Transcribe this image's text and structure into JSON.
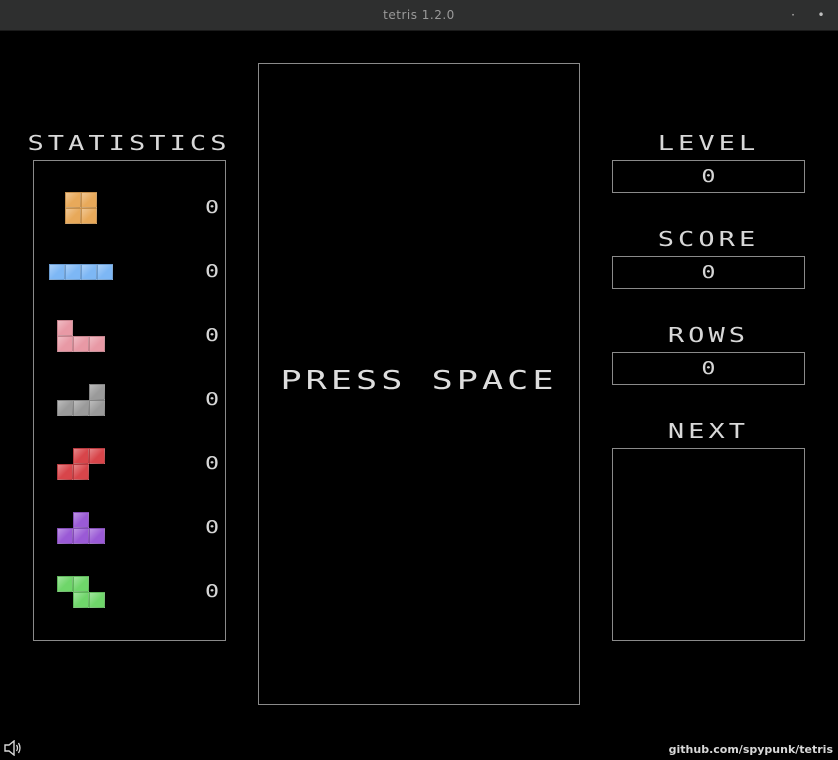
{
  "window": {
    "title": "tetris 1.2.0",
    "min_glyph": "·",
    "close_glyph": "•"
  },
  "statistics": {
    "heading": "STATISTICS",
    "pieces": [
      {
        "id": "O",
        "color": "#e8a95a",
        "count": "0"
      },
      {
        "id": "I",
        "color": "#7db7f5",
        "count": "0"
      },
      {
        "id": "L",
        "color": "#e899a5",
        "count": "0"
      },
      {
        "id": "J",
        "color": "#9a9a9a",
        "count": "0"
      },
      {
        "id": "Z",
        "color": "#d8454a",
        "count": "0"
      },
      {
        "id": "T",
        "color": "#9a5ad6",
        "count": "0"
      },
      {
        "id": "S",
        "color": "#6fd66a",
        "count": "0"
      }
    ]
  },
  "board": {
    "message": "PRESS SPACE"
  },
  "level": {
    "heading": "LEVEL",
    "value": "0"
  },
  "score": {
    "heading": "SCORE",
    "value": "0"
  },
  "rows": {
    "heading": "ROWS",
    "value": "0"
  },
  "next": {
    "heading": "NEXT"
  },
  "footer": {
    "link": "github.com/spypunk/tetris",
    "sound_icon": "speaker-icon"
  }
}
